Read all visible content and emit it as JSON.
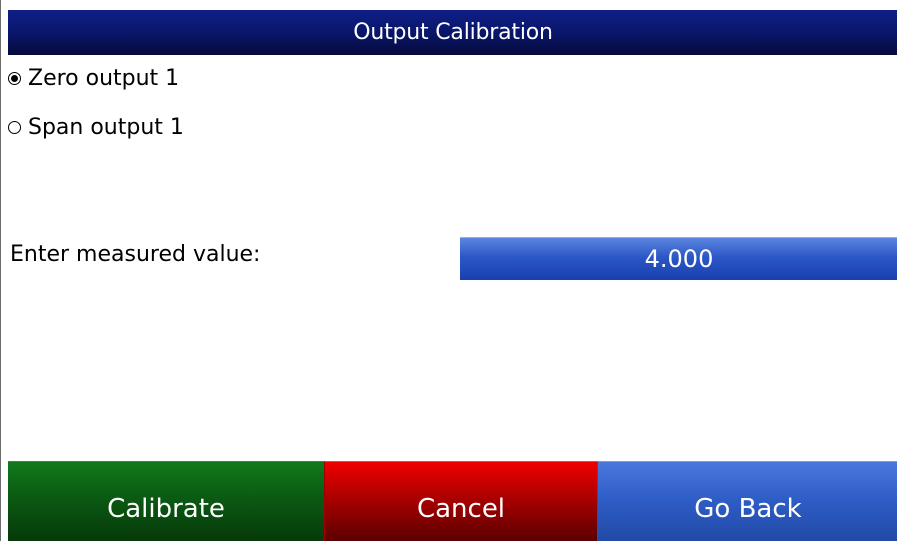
{
  "header": {
    "title": "Output Calibration"
  },
  "options": [
    {
      "label": "Zero output 1",
      "selected": true
    },
    {
      "label": "Span output 1",
      "selected": false
    }
  ],
  "measurement": {
    "label": "Enter measured value:",
    "value": "4.000"
  },
  "buttons": {
    "calibrate": "Calibrate",
    "cancel": "Cancel",
    "go_back": "Go Back"
  },
  "colors": {
    "title_bar": "#0a166b",
    "calibrate_button": "#0b5a13",
    "cancel_button": "#b30000",
    "go_back_button": "#2f5ec8",
    "value_field": "#2c57c7"
  }
}
